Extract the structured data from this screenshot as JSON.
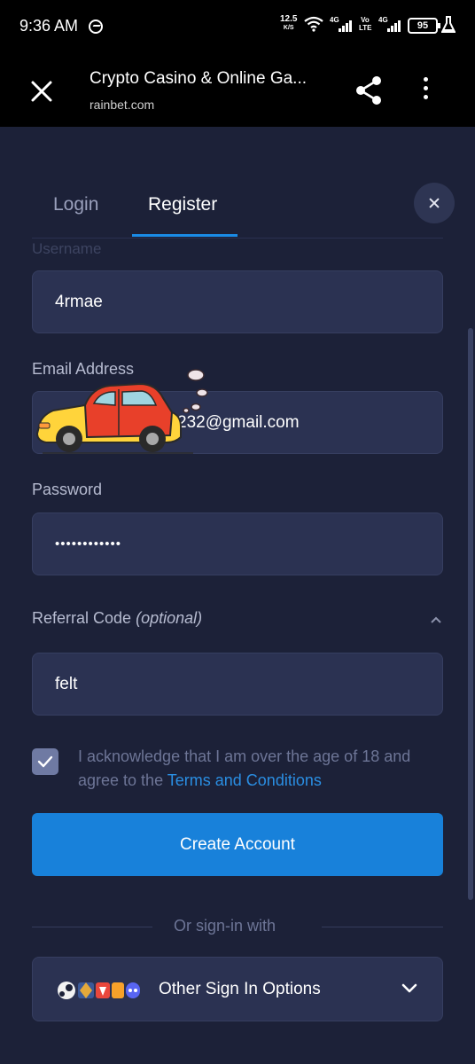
{
  "status_bar": {
    "time": "9:36 AM",
    "net_speed_value": "12.5",
    "net_speed_unit": "K/S",
    "net1": "4G",
    "volte": "Vo LTE",
    "net2": "4G",
    "battery": "95"
  },
  "browser": {
    "title": "Crypto Casino & Online Ga...",
    "url": "rainbet.com"
  },
  "tabs": [
    {
      "label": "Login",
      "active": false
    },
    {
      "label": "Register",
      "active": true
    }
  ],
  "form": {
    "username_label": "Username",
    "username_value": "4rmae",
    "email_label": "Email Address",
    "email_value_visible": "232@gmail.com",
    "password_label": "Password",
    "password_value": "••••••••••••",
    "referral_label": "Referral Code",
    "referral_optional": "(optional)",
    "referral_value": "felt",
    "age_checked": true,
    "age_text": "I acknowledge that I am over the age of 18 and agree to the",
    "terms_link": "Terms and Conditions",
    "submit_label": "Create Account"
  },
  "signin": {
    "divider_text": "Or sign-in with",
    "other_options_label": "Other Sign In Options"
  },
  "colors": {
    "background": "#1c2138",
    "field": "#2b3252",
    "accent": "#1881da",
    "link": "#2a8ee2"
  }
}
